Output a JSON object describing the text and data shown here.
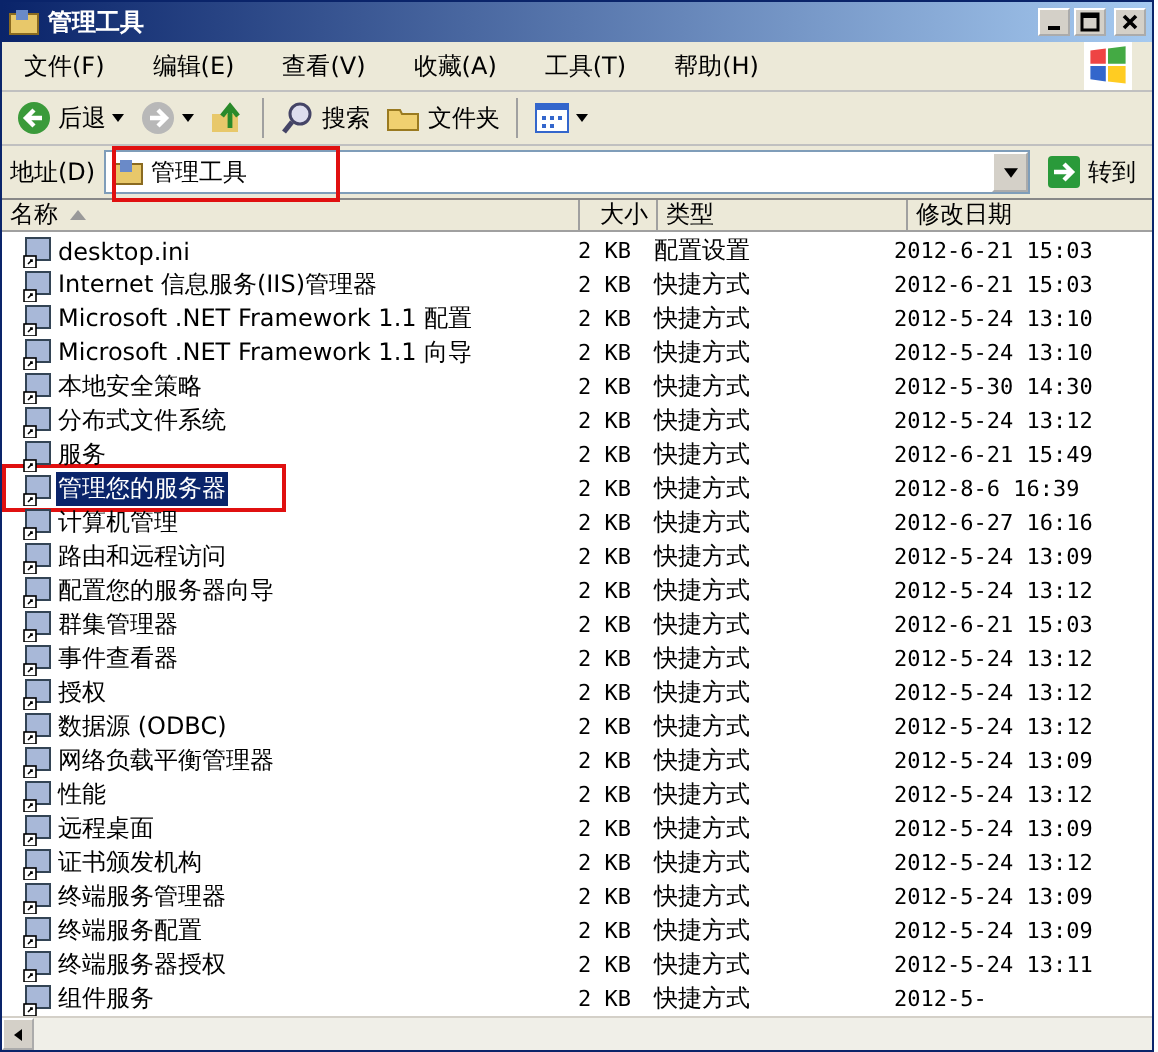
{
  "window": {
    "title": "管理工具"
  },
  "menu": [
    "文件(F)",
    "编辑(E)",
    "查看(V)",
    "收藏(A)",
    "工具(T)",
    "帮助(H)"
  ],
  "toolbar": [
    {
      "kind": "back",
      "label": "后退"
    },
    {
      "kind": "forward"
    },
    {
      "kind": "up"
    },
    {
      "kind": "search",
      "label": "搜索"
    },
    {
      "kind": "folders",
      "label": "文件夹"
    },
    {
      "kind": "views"
    }
  ],
  "address": {
    "label": "地址(D)",
    "value": "管理工具",
    "highlighted": true,
    "go": "转到"
  },
  "table": {
    "columns": [
      "名称",
      "大小",
      "类型",
      "修改日期"
    ],
    "rows": [
      {
        "name": "desktop.ini",
        "size": "2 KB",
        "type": "配置设置",
        "date": "2012-6-21 15:03",
        "selected": false,
        "highlighted": false
      },
      {
        "name": "Internet 信息服务(IIS)管理器",
        "size": "2 KB",
        "type": "快捷方式",
        "date": "2012-6-21 15:03",
        "selected": false,
        "highlighted": false
      },
      {
        "name": "Microsoft .NET Framework 1.1 配置",
        "size": "2 KB",
        "type": "快捷方式",
        "date": "2012-5-24 13:10",
        "selected": false,
        "highlighted": false
      },
      {
        "name": "Microsoft .NET Framework 1.1 向导",
        "size": "2 KB",
        "type": "快捷方式",
        "date": "2012-5-24 13:10",
        "selected": false,
        "highlighted": false
      },
      {
        "name": "本地安全策略",
        "size": "2 KB",
        "type": "快捷方式",
        "date": "2012-5-30 14:30",
        "selected": false,
        "highlighted": false
      },
      {
        "name": "分布式文件系统",
        "size": "2 KB",
        "type": "快捷方式",
        "date": "2012-5-24 13:12",
        "selected": false,
        "highlighted": false
      },
      {
        "name": "服务",
        "size": "2 KB",
        "type": "快捷方式",
        "date": "2012-6-21 15:49",
        "selected": false,
        "highlighted": false
      },
      {
        "name": "管理您的服务器",
        "size": "2 KB",
        "type": "快捷方式",
        "date": "2012-8-6 16:39",
        "selected": true,
        "highlighted": true
      },
      {
        "name": "计算机管理",
        "size": "2 KB",
        "type": "快捷方式",
        "date": "2012-6-27 16:16",
        "selected": false,
        "highlighted": false
      },
      {
        "name": "路由和远程访问",
        "size": "2 KB",
        "type": "快捷方式",
        "date": "2012-5-24 13:09",
        "selected": false,
        "highlighted": false
      },
      {
        "name": "配置您的服务器向导",
        "size": "2 KB",
        "type": "快捷方式",
        "date": "2012-5-24 13:12",
        "selected": false,
        "highlighted": false
      },
      {
        "name": "群集管理器",
        "size": "2 KB",
        "type": "快捷方式",
        "date": "2012-6-21 15:03",
        "selected": false,
        "highlighted": false
      },
      {
        "name": "事件查看器",
        "size": "2 KB",
        "type": "快捷方式",
        "date": "2012-5-24 13:12",
        "selected": false,
        "highlighted": false
      },
      {
        "name": "授权",
        "size": "2 KB",
        "type": "快捷方式",
        "date": "2012-5-24 13:12",
        "selected": false,
        "highlighted": false
      },
      {
        "name": "数据源 (ODBC)",
        "size": "2 KB",
        "type": "快捷方式",
        "date": "2012-5-24 13:12",
        "selected": false,
        "highlighted": false
      },
      {
        "name": "网络负载平衡管理器",
        "size": "2 KB",
        "type": "快捷方式",
        "date": "2012-5-24 13:09",
        "selected": false,
        "highlighted": false
      },
      {
        "name": "性能",
        "size": "2 KB",
        "type": "快捷方式",
        "date": "2012-5-24 13:12",
        "selected": false,
        "highlighted": false
      },
      {
        "name": "远程桌面",
        "size": "2 KB",
        "type": "快捷方式",
        "date": "2012-5-24 13:09",
        "selected": false,
        "highlighted": false
      },
      {
        "name": "证书颁发机构",
        "size": "2 KB",
        "type": "快捷方式",
        "date": "2012-5-24 13:12",
        "selected": false,
        "highlighted": false
      },
      {
        "name": "终端服务管理器",
        "size": "2 KB",
        "type": "快捷方式",
        "date": "2012-5-24 13:09",
        "selected": false,
        "highlighted": false
      },
      {
        "name": "终端服务配置",
        "size": "2 KB",
        "type": "快捷方式",
        "date": "2012-5-24 13:09",
        "selected": false,
        "highlighted": false
      },
      {
        "name": "终端服务器授权",
        "size": "2 KB",
        "type": "快捷方式",
        "date": "2012-5-24 13:11",
        "selected": false,
        "highlighted": false
      },
      {
        "name": "组件服务",
        "size": "2 KB",
        "type": "快捷方式",
        "date": "2012-5-",
        "selected": false,
        "highlighted": false
      }
    ]
  }
}
